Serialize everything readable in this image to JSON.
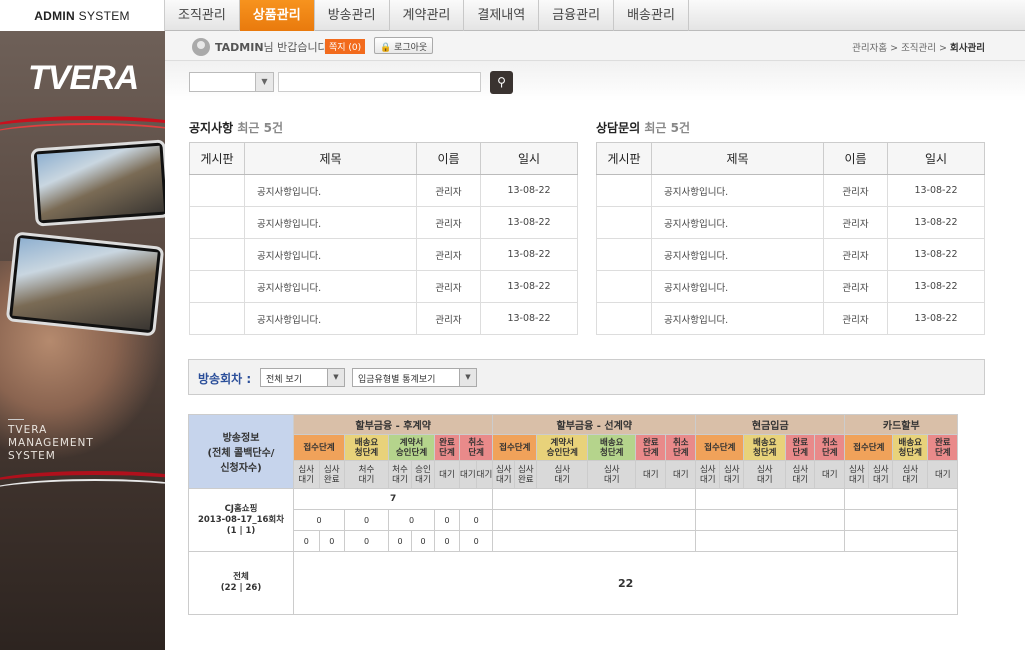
{
  "brand": {
    "logo_bold": "ADMIN",
    "logo_thin": "SYSTEM",
    "side_logo": "TVERA",
    "side_subtitle": [
      "TVERA",
      "MANAGEMENT",
      "SYSTEM"
    ]
  },
  "nav": [
    "조직관리",
    "상품관리",
    "방송관리",
    "계약관리",
    "결제내역",
    "금융관리",
    "배송관리"
  ],
  "nav_active": 1,
  "subbar": {
    "user": "TADMIN",
    "welcome_suffix": "님 반갑습니다.",
    "badge": "쪽지 (0)",
    "logout": "로그아웃",
    "crumb_prefix": "관리자홈 > 조직관리 > ",
    "crumb_current": "회사관리"
  },
  "search": {
    "select_value": "",
    "input_value": "",
    "button_icon": "search-icon"
  },
  "notice": {
    "title": "공지사항",
    "suffix": "최근 5건",
    "columns": [
      "게시판",
      "제목",
      "이름",
      "일시"
    ],
    "rows": [
      [
        "",
        "공지사항입니다.",
        "관리자",
        "13-08-22"
      ],
      [
        "",
        "공지사항입니다.",
        "관리자",
        "13-08-22"
      ],
      [
        "",
        "공지사항입니다.",
        "관리자",
        "13-08-22"
      ],
      [
        "",
        "공지사항입니다.",
        "관리자",
        "13-08-22"
      ],
      [
        "",
        "공지사항입니다.",
        "관리자",
        "13-08-22"
      ]
    ]
  },
  "consult": {
    "title": "상담문의",
    "suffix": "최근 5건",
    "columns": [
      "게시판",
      "제목",
      "이름",
      "일시"
    ],
    "rows": [
      [
        "",
        "공지사항입니다.",
        "관리자",
        "13-08-22"
      ],
      [
        "",
        "공지사항입니다.",
        "관리자",
        "13-08-22"
      ],
      [
        "",
        "공지사항입니다.",
        "관리자",
        "13-08-22"
      ],
      [
        "",
        "공지사항입니다.",
        "관리자",
        "13-08-22"
      ],
      [
        "",
        "공지사항입니다.",
        "관리자",
        "13-08-22"
      ]
    ]
  },
  "filter": {
    "label": "방송회차 :",
    "select1": "전체 보기",
    "select2": "입금유형별 통계보기"
  },
  "stats": {
    "corner": "방송정보\n(전체 콜백단수/\n신청자수)",
    "groups": [
      "할부금융 - 후계약",
      "할부금융 - 선계약",
      "현금입금",
      "카드할부"
    ],
    "episode": "CJ홈쇼핑\n2013-08-17_16회차\n(1 | 1)",
    "episode_value": "7",
    "total_label": "전체\n(22 | 26)",
    "total_value": "22"
  },
  "colors": {
    "accent": "#f7931e",
    "blue": "#2b4f9a",
    "brown": "#d9bfa8"
  }
}
